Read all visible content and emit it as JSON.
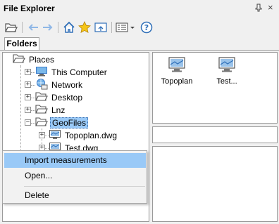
{
  "window": {
    "title": "File Explorer",
    "pin_glyph": "ᴪ",
    "close_glyph": "×"
  },
  "toolbar": {
    "buttons": [
      {
        "icon": "open-folder-icon"
      },
      {
        "icon": "back-arrow-icon"
      },
      {
        "icon": "forward-arrow-icon"
      },
      {
        "icon": "home-icon"
      },
      {
        "icon": "favorites-star-icon"
      },
      {
        "icon": "up-folder-icon"
      },
      {
        "icon": "view-mode-icon"
      },
      {
        "icon": "help-icon"
      }
    ]
  },
  "tabs": [
    {
      "label": "Folders"
    }
  ],
  "tree": {
    "items": [
      {
        "label": "Places"
      },
      {
        "label": "This Computer"
      },
      {
        "label": "Network"
      },
      {
        "label": "Desktop"
      },
      {
        "label": "Lnz"
      },
      {
        "label": "GeoFiles",
        "selected": true
      },
      {
        "label": "Topoplan.dwg"
      },
      {
        "label": "Test.dwg"
      }
    ]
  },
  "files": [
    {
      "name": "Topoplan"
    },
    {
      "name": "Test..."
    }
  ],
  "context_menu": {
    "items": [
      {
        "label": "Import measurements",
        "highlighted": true
      },
      {
        "label": "Open..."
      },
      {
        "label": "Delete"
      }
    ]
  },
  "colors": {
    "selection": "#99c9f7",
    "accent_blue": "#3d7cc9",
    "folder": "#6b6b6b"
  }
}
